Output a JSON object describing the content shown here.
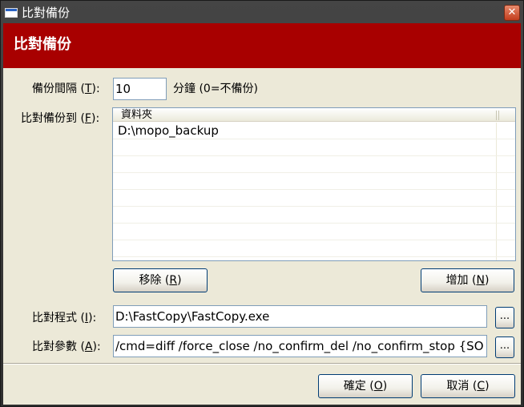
{
  "window": {
    "title": "比對備份",
    "close_glyph": "✕"
  },
  "banner": {
    "title": "比對備份"
  },
  "interval": {
    "label": "備份間隔 (",
    "mnemonic": "T",
    "label_end": "):",
    "value": "10",
    "unit": "分鐘 (0=不備份)"
  },
  "dest": {
    "label": "比對備份到 (",
    "mnemonic": "F",
    "label_end": "):",
    "column": "資料夾",
    "rows": [
      "D:\\mopo_backup",
      "",
      "",
      "",
      "",
      "",
      "",
      ""
    ]
  },
  "buttons": {
    "remove": {
      "label": "移除 (",
      "mnemonic": "R",
      "end": ")"
    },
    "add": {
      "label": "增加 (",
      "mnemonic": "N",
      "end": ")"
    },
    "browse_program": "...",
    "browse_params": "...",
    "ok": {
      "label": "確定 (",
      "mnemonic": "O",
      "end": ")"
    },
    "cancel": {
      "label": "取消 (",
      "mnemonic": "C",
      "end": ")"
    }
  },
  "program": {
    "label": "比對程式 (",
    "mnemonic": "I",
    "label_end": "):",
    "value": "D:\\FastCopy\\FastCopy.exe"
  },
  "params": {
    "label": "比對參數 (",
    "mnemonic": "A",
    "label_end": "):",
    "value": "/cmd=diff /force_close /no_confirm_del /no_confirm_stop {SO"
  },
  "colors": {
    "banner": "#a80000",
    "dialog_bg": "#ece9d8",
    "button_border": "#003c74"
  }
}
